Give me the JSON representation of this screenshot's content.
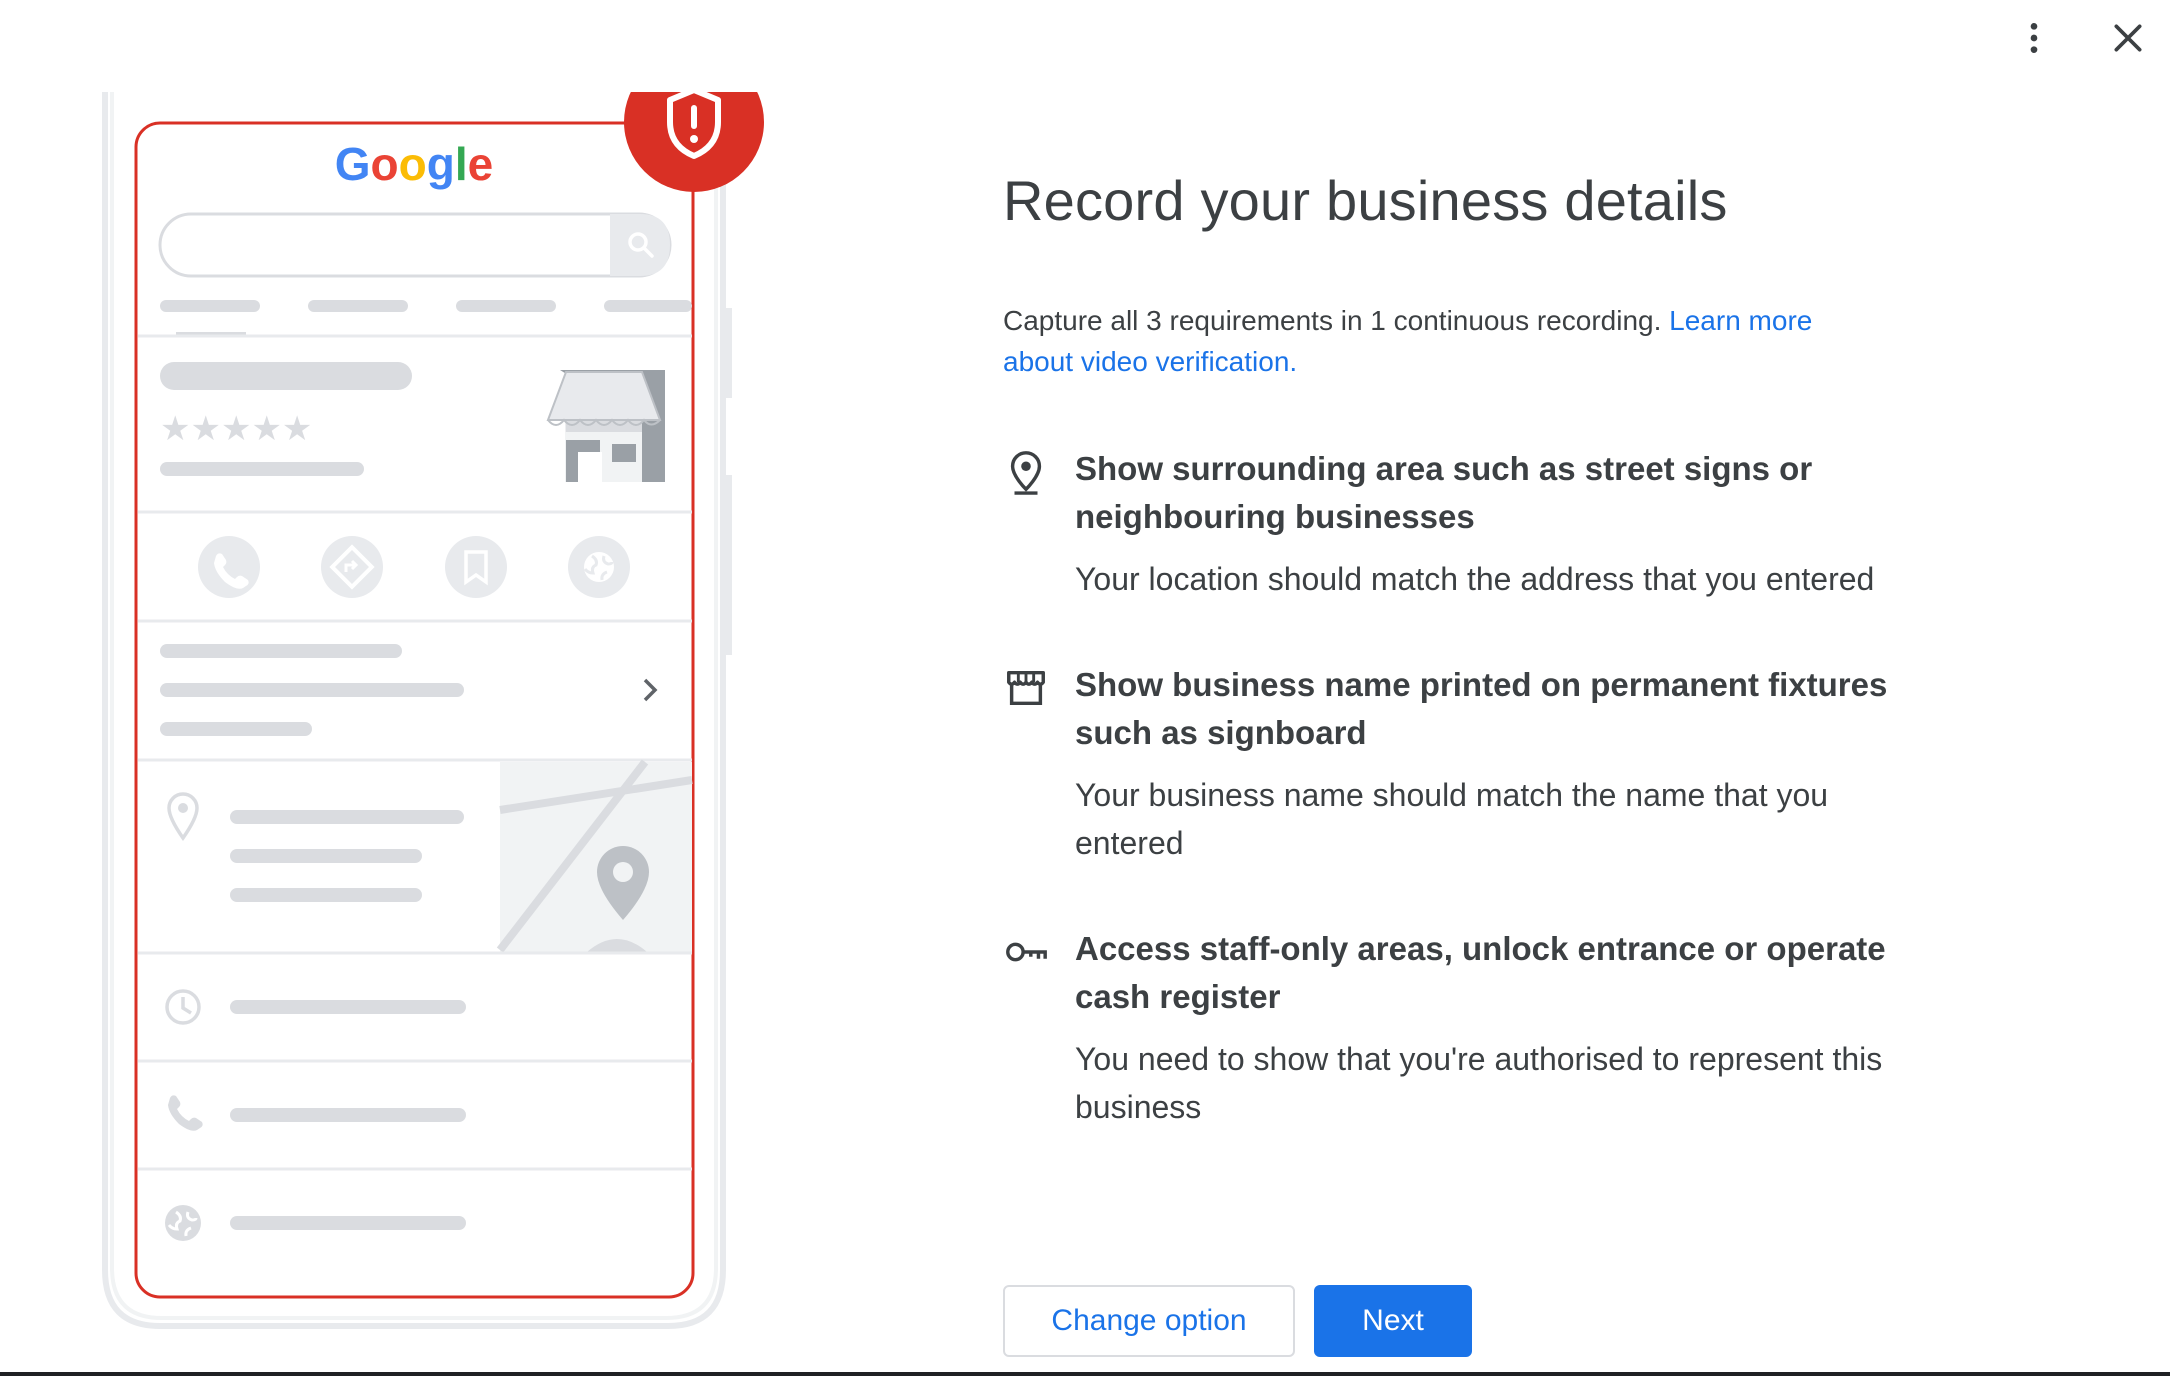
{
  "toolbar": {
    "more_icon": "more-vert-icon",
    "close_icon": "close-icon"
  },
  "illustration": {
    "logo_text": "Google",
    "brand_colors": [
      "#4285F4",
      "#EA4335",
      "#FBBC05",
      "#4285F4",
      "#34A853",
      "#EA4335"
    ],
    "alert_color": "#D93025",
    "alert_icon": "shield-alert-icon",
    "action_icons": [
      "phone-icon",
      "directions-icon",
      "bookmark-icon",
      "globe-icon"
    ],
    "rating_stars": 5
  },
  "main": {
    "title": "Record your business details",
    "intro": "Capture all 3 requirements in 1 continuous recording. ",
    "learn_more_link": "Learn more about video verification.",
    "requirements": [
      {
        "icon": "location-pin-icon",
        "title": "Show surrounding area such as street signs or neighbouring businesses",
        "description": "Your location should match the address that you entered"
      },
      {
        "icon": "storefront-icon",
        "title": "Show business name printed on permanent fixtures such as signboard",
        "description": "Your business name should match the name that you entered"
      },
      {
        "icon": "key-icon",
        "title": "Access staff-only areas, unlock entrance or operate cash register",
        "description": "You need to show that you're authorised to represent this business"
      }
    ]
  },
  "actions": {
    "change_option_label": "Change option",
    "next_label": "Next"
  },
  "colors": {
    "accent": "#1a73e8",
    "text": "#3c4043",
    "placeholder_gray": "#dadce0"
  }
}
